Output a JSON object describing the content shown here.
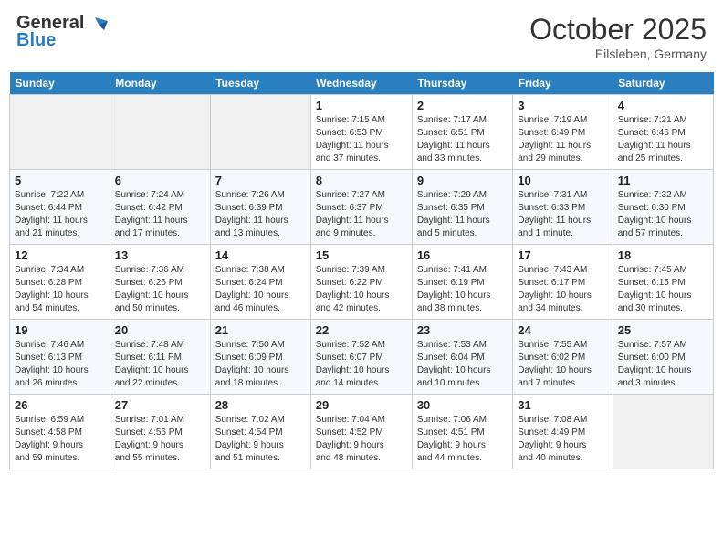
{
  "header": {
    "logo_general": "General",
    "logo_blue": "Blue",
    "month": "October 2025",
    "location": "Eilsleben, Germany"
  },
  "weekdays": [
    "Sunday",
    "Monday",
    "Tuesday",
    "Wednesday",
    "Thursday",
    "Friday",
    "Saturday"
  ],
  "weeks": [
    [
      {
        "day": "",
        "info": ""
      },
      {
        "day": "",
        "info": ""
      },
      {
        "day": "",
        "info": ""
      },
      {
        "day": "1",
        "info": "Sunrise: 7:15 AM\nSunset: 6:53 PM\nDaylight: 11 hours\nand 37 minutes."
      },
      {
        "day": "2",
        "info": "Sunrise: 7:17 AM\nSunset: 6:51 PM\nDaylight: 11 hours\nand 33 minutes."
      },
      {
        "day": "3",
        "info": "Sunrise: 7:19 AM\nSunset: 6:49 PM\nDaylight: 11 hours\nand 29 minutes."
      },
      {
        "day": "4",
        "info": "Sunrise: 7:21 AM\nSunset: 6:46 PM\nDaylight: 11 hours\nand 25 minutes."
      }
    ],
    [
      {
        "day": "5",
        "info": "Sunrise: 7:22 AM\nSunset: 6:44 PM\nDaylight: 11 hours\nand 21 minutes."
      },
      {
        "day": "6",
        "info": "Sunrise: 7:24 AM\nSunset: 6:42 PM\nDaylight: 11 hours\nand 17 minutes."
      },
      {
        "day": "7",
        "info": "Sunrise: 7:26 AM\nSunset: 6:39 PM\nDaylight: 11 hours\nand 13 minutes."
      },
      {
        "day": "8",
        "info": "Sunrise: 7:27 AM\nSunset: 6:37 PM\nDaylight: 11 hours\nand 9 minutes."
      },
      {
        "day": "9",
        "info": "Sunrise: 7:29 AM\nSunset: 6:35 PM\nDaylight: 11 hours\nand 5 minutes."
      },
      {
        "day": "10",
        "info": "Sunrise: 7:31 AM\nSunset: 6:33 PM\nDaylight: 11 hours\nand 1 minute."
      },
      {
        "day": "11",
        "info": "Sunrise: 7:32 AM\nSunset: 6:30 PM\nDaylight: 10 hours\nand 57 minutes."
      }
    ],
    [
      {
        "day": "12",
        "info": "Sunrise: 7:34 AM\nSunset: 6:28 PM\nDaylight: 10 hours\nand 54 minutes."
      },
      {
        "day": "13",
        "info": "Sunrise: 7:36 AM\nSunset: 6:26 PM\nDaylight: 10 hours\nand 50 minutes."
      },
      {
        "day": "14",
        "info": "Sunrise: 7:38 AM\nSunset: 6:24 PM\nDaylight: 10 hours\nand 46 minutes."
      },
      {
        "day": "15",
        "info": "Sunrise: 7:39 AM\nSunset: 6:22 PM\nDaylight: 10 hours\nand 42 minutes."
      },
      {
        "day": "16",
        "info": "Sunrise: 7:41 AM\nSunset: 6:19 PM\nDaylight: 10 hours\nand 38 minutes."
      },
      {
        "day": "17",
        "info": "Sunrise: 7:43 AM\nSunset: 6:17 PM\nDaylight: 10 hours\nand 34 minutes."
      },
      {
        "day": "18",
        "info": "Sunrise: 7:45 AM\nSunset: 6:15 PM\nDaylight: 10 hours\nand 30 minutes."
      }
    ],
    [
      {
        "day": "19",
        "info": "Sunrise: 7:46 AM\nSunset: 6:13 PM\nDaylight: 10 hours\nand 26 minutes."
      },
      {
        "day": "20",
        "info": "Sunrise: 7:48 AM\nSunset: 6:11 PM\nDaylight: 10 hours\nand 22 minutes."
      },
      {
        "day": "21",
        "info": "Sunrise: 7:50 AM\nSunset: 6:09 PM\nDaylight: 10 hours\nand 18 minutes."
      },
      {
        "day": "22",
        "info": "Sunrise: 7:52 AM\nSunset: 6:07 PM\nDaylight: 10 hours\nand 14 minutes."
      },
      {
        "day": "23",
        "info": "Sunrise: 7:53 AM\nSunset: 6:04 PM\nDaylight: 10 hours\nand 10 minutes."
      },
      {
        "day": "24",
        "info": "Sunrise: 7:55 AM\nSunset: 6:02 PM\nDaylight: 10 hours\nand 7 minutes."
      },
      {
        "day": "25",
        "info": "Sunrise: 7:57 AM\nSunset: 6:00 PM\nDaylight: 10 hours\nand 3 minutes."
      }
    ],
    [
      {
        "day": "26",
        "info": "Sunrise: 6:59 AM\nSunset: 4:58 PM\nDaylight: 9 hours\nand 59 minutes."
      },
      {
        "day": "27",
        "info": "Sunrise: 7:01 AM\nSunset: 4:56 PM\nDaylight: 9 hours\nand 55 minutes."
      },
      {
        "day": "28",
        "info": "Sunrise: 7:02 AM\nSunset: 4:54 PM\nDaylight: 9 hours\nand 51 minutes."
      },
      {
        "day": "29",
        "info": "Sunrise: 7:04 AM\nSunset: 4:52 PM\nDaylight: 9 hours\nand 48 minutes."
      },
      {
        "day": "30",
        "info": "Sunrise: 7:06 AM\nSunset: 4:51 PM\nDaylight: 9 hours\nand 44 minutes."
      },
      {
        "day": "31",
        "info": "Sunrise: 7:08 AM\nSunset: 4:49 PM\nDaylight: 9 hours\nand 40 minutes."
      },
      {
        "day": "",
        "info": ""
      }
    ]
  ]
}
